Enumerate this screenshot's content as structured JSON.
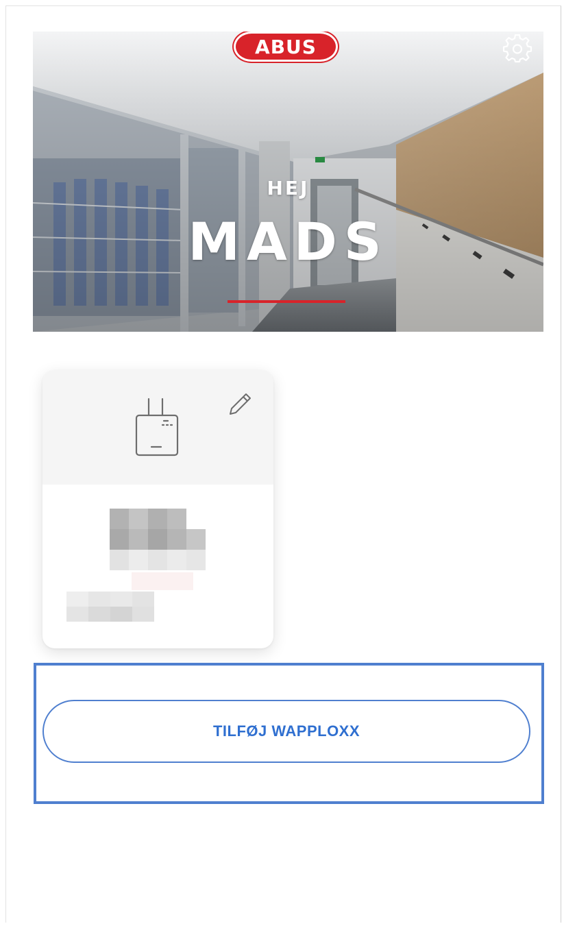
{
  "header": {
    "brand": "ABUS",
    "greeting": "HEJ",
    "user_name": "MADS",
    "settings_icon": "gear-icon",
    "accent_color": "#d8232a"
  },
  "device_card": {
    "icon": "router-device-icon",
    "edit_icon": "pencil-icon",
    "name": "",
    "subtitle": ""
  },
  "actions": {
    "add_label": "TILFØJ WAPPLOXX",
    "accent_color": "#4f7fcf"
  }
}
